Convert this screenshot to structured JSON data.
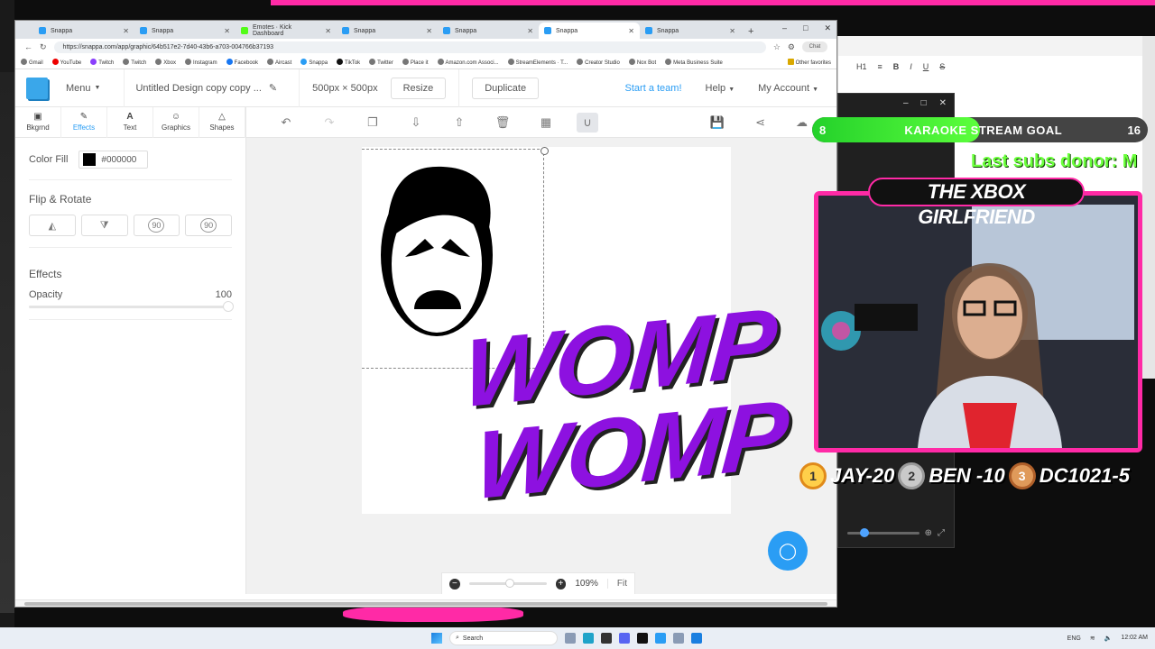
{
  "browser": {
    "tabs": [
      {
        "title": "Snappa",
        "icon": "snappa",
        "active": false
      },
      {
        "title": "Snappa",
        "icon": "snappa",
        "active": false
      },
      {
        "title": "Emotes · Kick Dashboard",
        "icon": "kick",
        "active": false
      },
      {
        "title": "Snappa",
        "icon": "snappa",
        "active": false
      },
      {
        "title": "Snappa",
        "icon": "snappa",
        "active": false
      },
      {
        "title": "Snappa",
        "icon": "snappa",
        "active": true
      },
      {
        "title": "Snappa",
        "icon": "snappa",
        "active": false
      }
    ],
    "url": "https://snappa.com/app/graphic/64b517e2-7d40-43b6-a703-004766b37193",
    "chat_label": "Chat",
    "bookmarks": [
      "Gmail",
      "YouTube",
      "Twitch",
      "Twitch",
      "Xbox",
      "Instagram",
      "Facebook",
      "Aircast",
      "Snappa",
      "TikTok",
      "Twitter",
      "Place it",
      "Amazon.com Associ...",
      "StreamElements · T...",
      "Creator Studio",
      "Nox Bot",
      "Meta Business Suite"
    ],
    "other_favorites": "Other favorites"
  },
  "app": {
    "menu_label": "Menu",
    "doc_name": "Untitled Design copy copy ...",
    "dimensions": "500px × 500px",
    "resize_label": "Resize",
    "duplicate_label": "Duplicate",
    "start_team_label": "Start a team!",
    "help_label": "Help",
    "account_label": "My Account",
    "left_tools": [
      {
        "label": "Bkgrnd",
        "icon": "image-icon",
        "glyph": "▣"
      },
      {
        "label": "Effects",
        "icon": "wand-icon",
        "glyph": "✎"
      },
      {
        "label": "Text",
        "icon": "text-icon",
        "glyph": "A"
      },
      {
        "label": "Graphics",
        "icon": "smiley-icon",
        "glyph": "☺"
      },
      {
        "label": "Shapes",
        "icon": "triangle-icon",
        "glyph": "△"
      }
    ],
    "panel": {
      "color_fill_label": "Color Fill",
      "color_fill_value": "#000000",
      "flip_rotate_label": "Flip & Rotate",
      "rotate_left_label": "90",
      "rotate_right_label": "90",
      "effects_label": "Effects",
      "opacity_label": "Opacity",
      "opacity_value": "100"
    },
    "canvas": {
      "line1": "WOMP",
      "line2": "WOMP",
      "text_color": "#8d11e0"
    },
    "zoom": {
      "level": "109%",
      "fit_label": "Fit"
    }
  },
  "right_browser": {
    "tools": [
      "H1",
      "≡",
      "B",
      "I",
      "U",
      "S"
    ]
  },
  "overlays": {
    "goal": {
      "current": "8",
      "title": "KARAOKE STREAM GOAL",
      "target": "16",
      "progress": 0.5
    },
    "last_subs": "Last subs donor: M",
    "cam_title": "THE XBOX GIRLFRIEND",
    "leaders": [
      {
        "rank": "1",
        "text": "JAY-20"
      },
      {
        "rank": "2",
        "text": "BEN -10"
      },
      {
        "rank": "3",
        "text": "DC1021-5"
      }
    ]
  },
  "taskbar": {
    "search_placeholder": "Search",
    "lang": "ENG",
    "time": "12:02 AM"
  }
}
